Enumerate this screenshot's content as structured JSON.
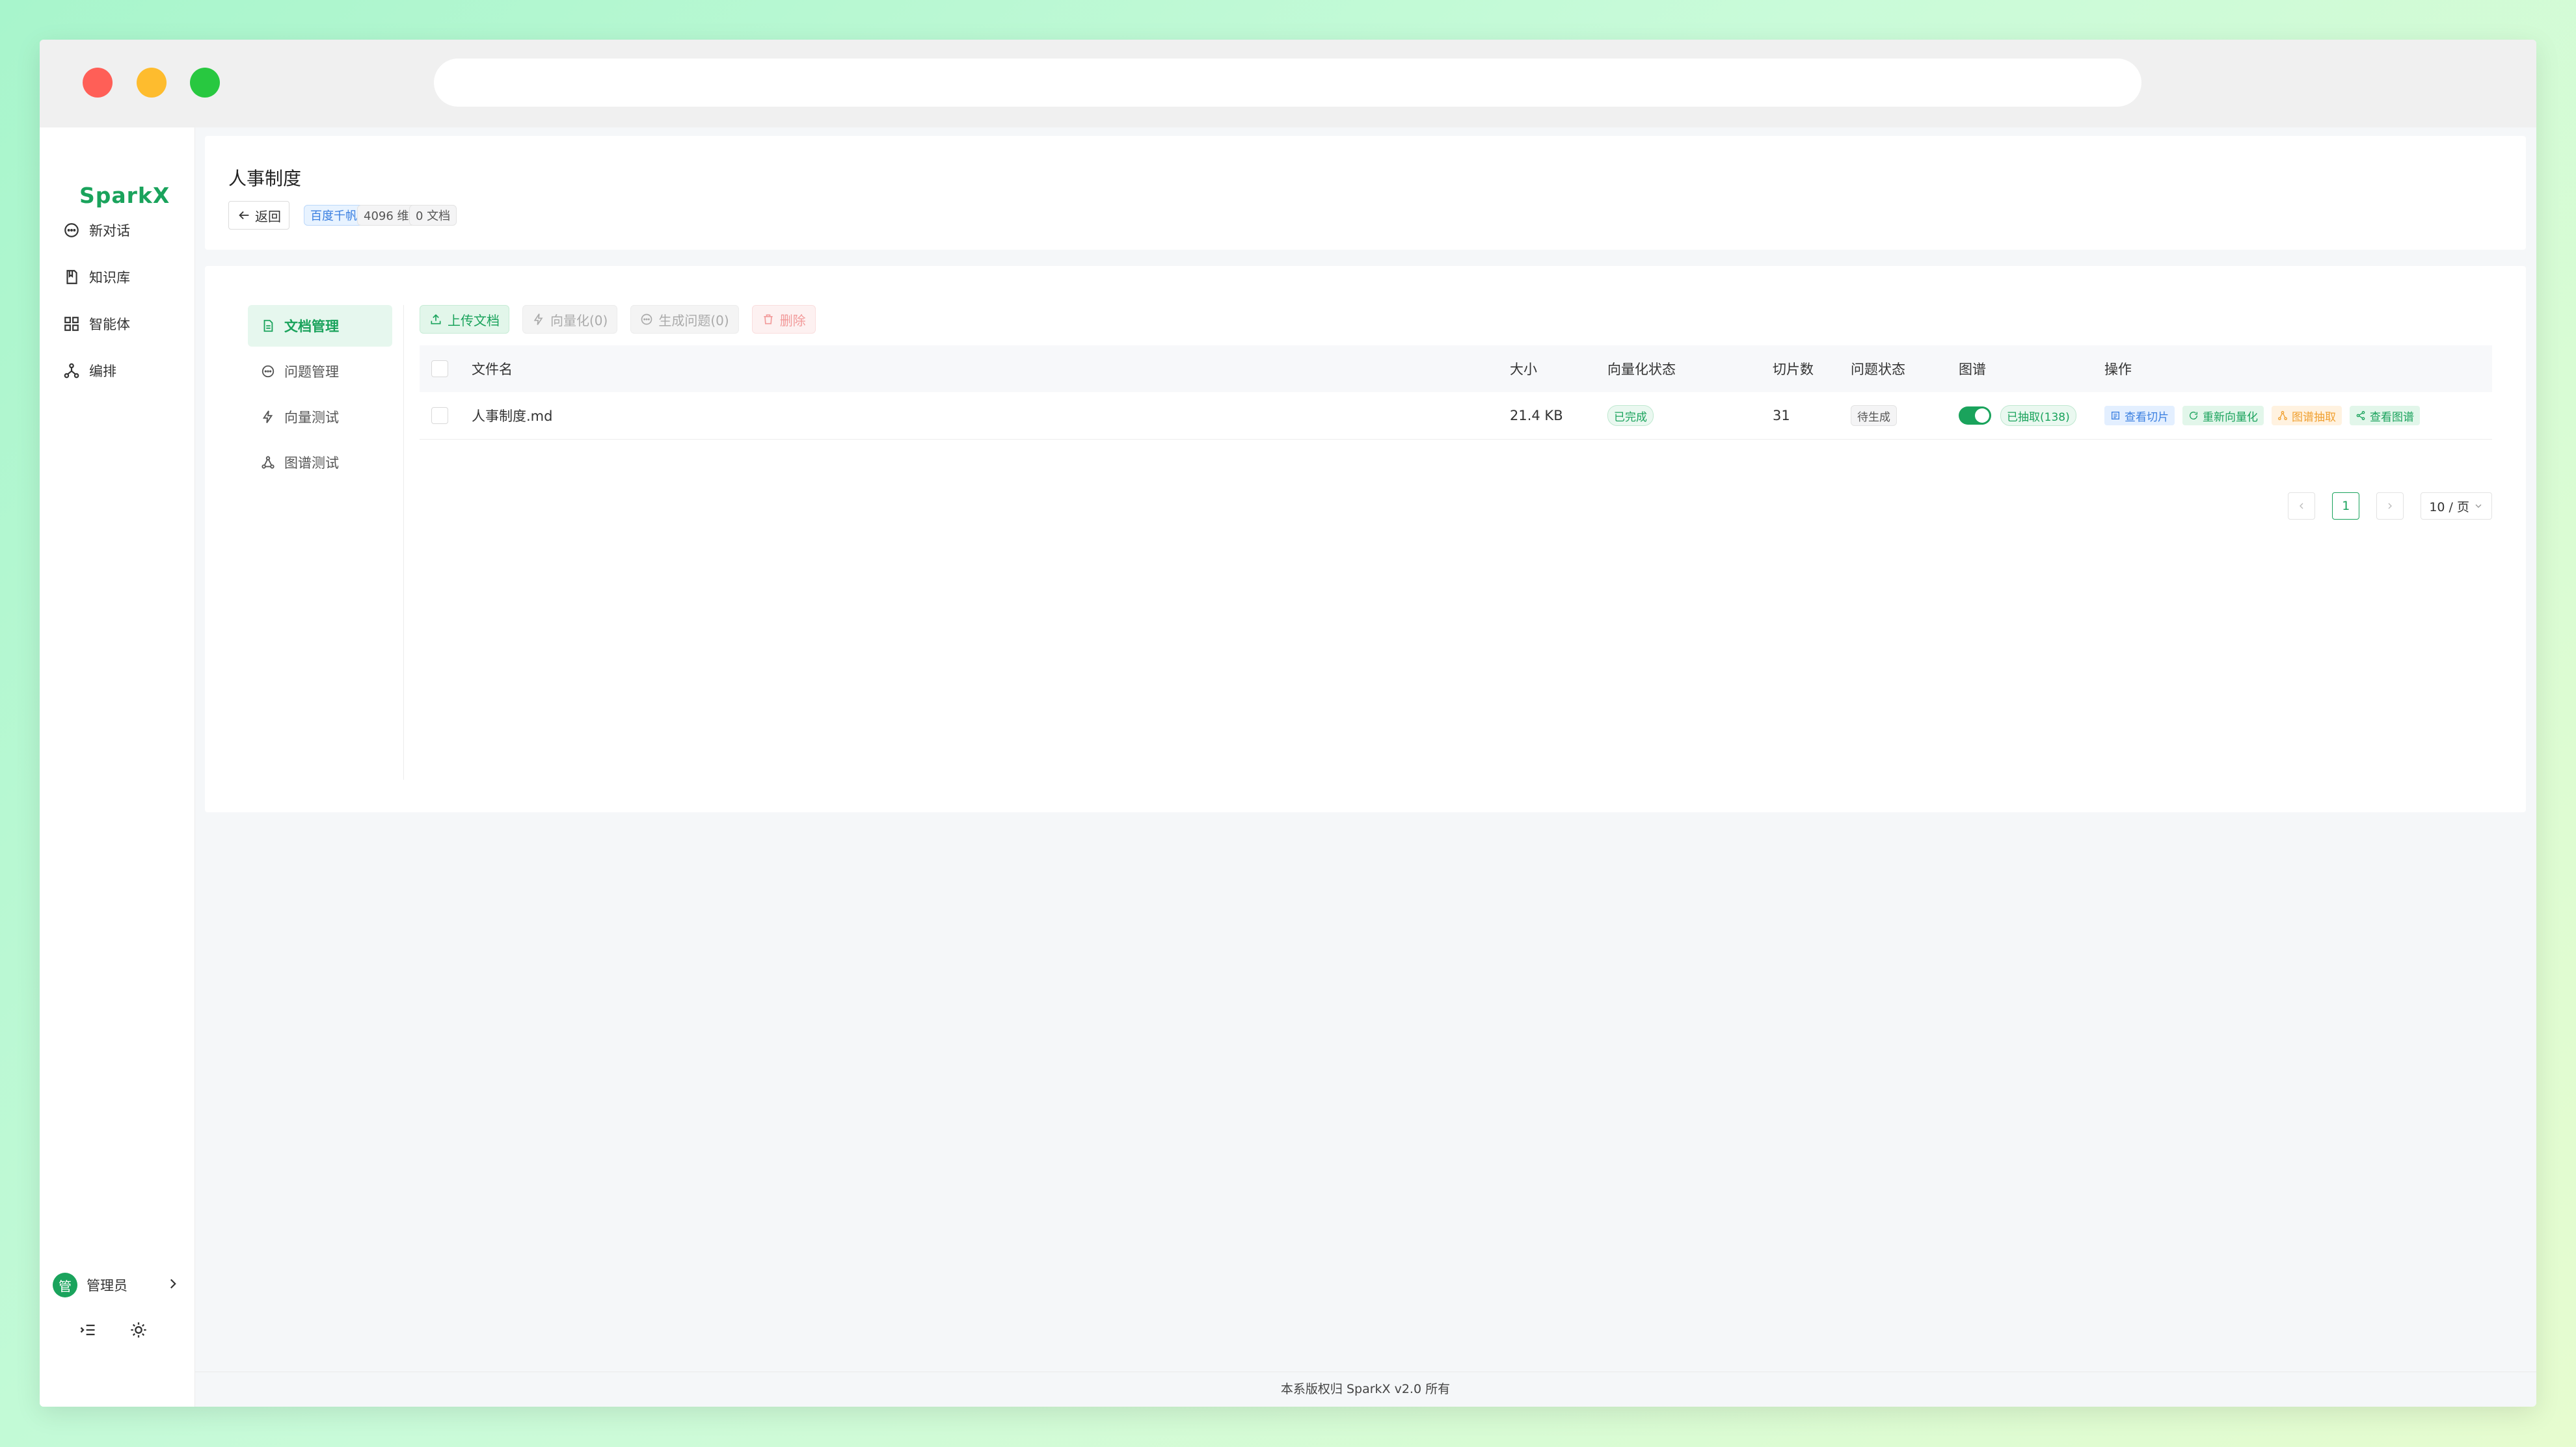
{
  "app": {
    "logo": "SparkX",
    "footer": "本系版权归 SparkX v2.0 所有"
  },
  "sidebar": {
    "items": [
      {
        "label": "新对话",
        "icon": "chat-bubble-icon"
      },
      {
        "label": "知识库",
        "icon": "book-icon"
      },
      {
        "label": "智能体",
        "icon": "grid-icon"
      },
      {
        "label": "编排",
        "icon": "workflow-icon"
      }
    ],
    "user": {
      "avatar": "管",
      "name": "管理员"
    }
  },
  "header": {
    "title": "人事制度",
    "back_label": "返回",
    "tags": [
      "百度千帆",
      "4096 维",
      "0 文档"
    ]
  },
  "subnav": {
    "items": [
      {
        "label": "文档管理",
        "active": true
      },
      {
        "label": "问题管理",
        "active": false
      },
      {
        "label": "向量测试",
        "active": false
      },
      {
        "label": "图谱测试",
        "active": false
      }
    ]
  },
  "toolbar": {
    "upload": "上传文档",
    "vectorize": "向量化(0)",
    "gen_questions": "生成问题(0)",
    "delete": "删除"
  },
  "table": {
    "columns": [
      "文件名",
      "大小",
      "向量化状态",
      "切片数",
      "问题状态",
      "图谱",
      "操作"
    ],
    "rows": [
      {
        "filename": "人事制度.md",
        "size": "21.4 KB",
        "vector_status": "已完成",
        "chunks": "31",
        "question_status": "待生成",
        "graph_status": "已抽取(138)",
        "graph_enabled": true,
        "actions": [
          "查看切片",
          "重新向量化",
          "图谱抽取",
          "查看图谱"
        ]
      }
    ]
  },
  "pagination": {
    "current": "1",
    "page_size": "10 / 页"
  },
  "colors": {
    "accent": "#1aa35c",
    "info": "#3a7fe0",
    "warning": "#f0a030",
    "danger": "#f29a9a"
  }
}
